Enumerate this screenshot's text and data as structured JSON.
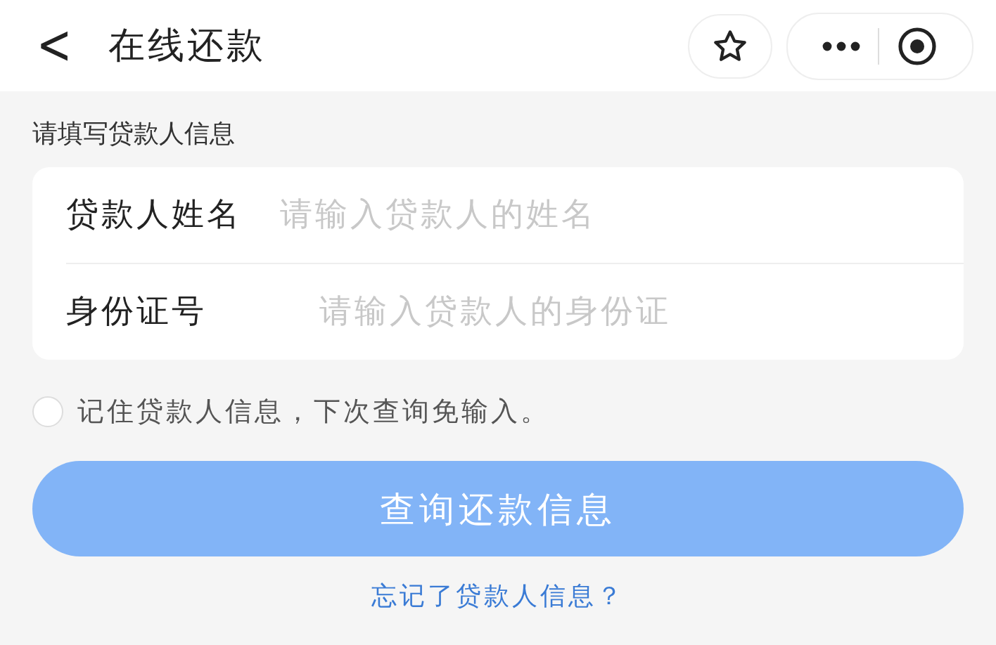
{
  "header": {
    "back": "<",
    "title": "在线还款"
  },
  "section_title": "请填写贷款人信息",
  "fields": [
    {
      "label": "贷款人姓名",
      "placeholder": "请输入贷款人的姓名"
    },
    {
      "label": "身份证号",
      "placeholder": "请输入贷款人的身份证"
    }
  ],
  "remember": {
    "label": "记住贷款人信息，下次查询免输入。",
    "checked": false
  },
  "submit": {
    "label": "查询还款信息",
    "disabled": true
  },
  "forgot_link": "忘记了贷款人信息？"
}
